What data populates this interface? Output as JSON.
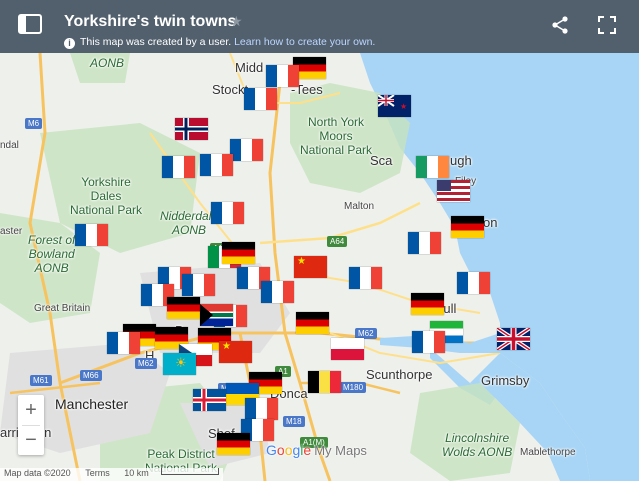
{
  "header": {
    "title": "Yorkshire's twin towns",
    "info_text": "This map was created by a user.",
    "info_link": "Learn how to create your own.",
    "info_icon": "i"
  },
  "map": {
    "cities": [
      {
        "name": "Middlesbrough_top",
        "text": "Midd"
      },
      {
        "name": "stockton",
        "text": "Stockt"
      },
      {
        "name": "tees",
        "text": "-Tees"
      },
      {
        "name": "scarborough_a",
        "text": "Sca"
      },
      {
        "name": "scarborough_b",
        "text": "ugh"
      },
      {
        "name": "filey",
        "text": "Filey"
      },
      {
        "name": "bridlington",
        "text": "on"
      },
      {
        "name": "malton",
        "text": "Malton"
      },
      {
        "name": "hull",
        "text": "Hull"
      },
      {
        "name": "scunthorpe",
        "text": "Scunthorpe"
      },
      {
        "name": "grimsby",
        "text": "Grimsby"
      },
      {
        "name": "doncaster",
        "text": "Donca"
      },
      {
        "name": "sheffield",
        "text": "Shef"
      },
      {
        "name": "great-britain",
        "text": "Great Britain"
      },
      {
        "name": "ndal",
        "text": "ndal"
      },
      {
        "name": "aster",
        "text": "aster"
      },
      {
        "name": "arrington",
        "text": "arrington"
      },
      {
        "name": "hx",
        "text": "H"
      },
      {
        "name": "b",
        "text": "B"
      },
      {
        "name": "mablethorpe",
        "text": "Mablethorpe"
      }
    ],
    "big_cities": [
      {
        "name": "manchester",
        "text": "Manchester"
      }
    ],
    "parks": [
      {
        "name": "north-york-moors",
        "lines": [
          "North York",
          "Moors",
          "National Park"
        ]
      },
      {
        "name": "yorkshire-dales",
        "lines": [
          "Yorkshire",
          "Dales",
          "National Park"
        ]
      },
      {
        "name": "peak-district",
        "lines": [
          "Peak District",
          "National Park"
        ]
      }
    ],
    "parks_italic": [
      {
        "name": "forest-of-bowland",
        "lines": [
          "Forest of",
          "Bowland",
          "AONB"
        ]
      },
      {
        "name": "nidderdale",
        "lines": [
          "Nidderdale",
          "AONB"
        ]
      },
      {
        "name": "lincolnshire-wolds",
        "lines": [
          "Lincolnshire",
          "Wolds AONB"
        ]
      },
      {
        "name": "aonb-top",
        "lines": [
          "AONB"
        ]
      }
    ],
    "roads_m": [
      "M6",
      "M66",
      "M61",
      "M62",
      "M180",
      "M18",
      "M1",
      "M62"
    ],
    "roads_a": [
      "A64",
      "A1",
      "A1(M)",
      "A1"
    ],
    "flag_labels": [
      "France",
      "Germany",
      "Belgium",
      "Ireland",
      "Italy",
      "Poland",
      "Sierra Leone",
      "China",
      "Czech Republic",
      "Kazakhstan",
      "Ukraine",
      "South Africa",
      "Norway",
      "Iceland",
      "United Kingdom",
      "New Zealand",
      "United States"
    ],
    "colors": {
      "sea": "#a8d5f5",
      "land": "#eef0ec",
      "park": "#c7e2bf",
      "motorway": "#f7c35f",
      "aroad": "#ffe08a",
      "header": "#52606e"
    }
  },
  "controls": {
    "zoom_in": "+",
    "zoom_out": "−"
  },
  "footer": {
    "map_data": "Map data ©2020",
    "terms": "Terms",
    "scale": "10 km"
  },
  "brand": {
    "g1": "G",
    "g2": "o",
    "g3": "o",
    "g4": "g",
    "g5": "l",
    "g6": "e",
    "my_maps": "My Maps"
  }
}
